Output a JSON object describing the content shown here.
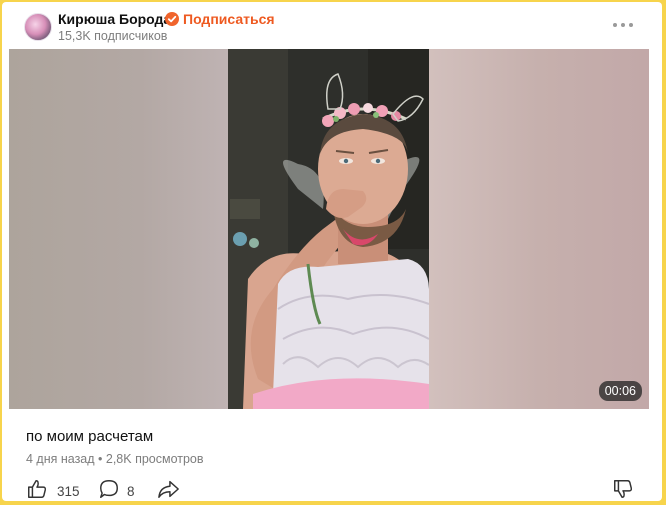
{
  "channel": {
    "name": "Кирюша Борода",
    "subscribe_label": "Подписаться",
    "subscribers": "15,3K подписчиков"
  },
  "video": {
    "duration": "00:06",
    "title": "по моим расчетам",
    "meta": "4 дня назад • 2,8K просмотров"
  },
  "actions": {
    "likes": "315",
    "comments": "8"
  },
  "colors": {
    "accent": "#ee5a21",
    "verified": "#f0642c",
    "frame_border": "#f7d44c"
  }
}
